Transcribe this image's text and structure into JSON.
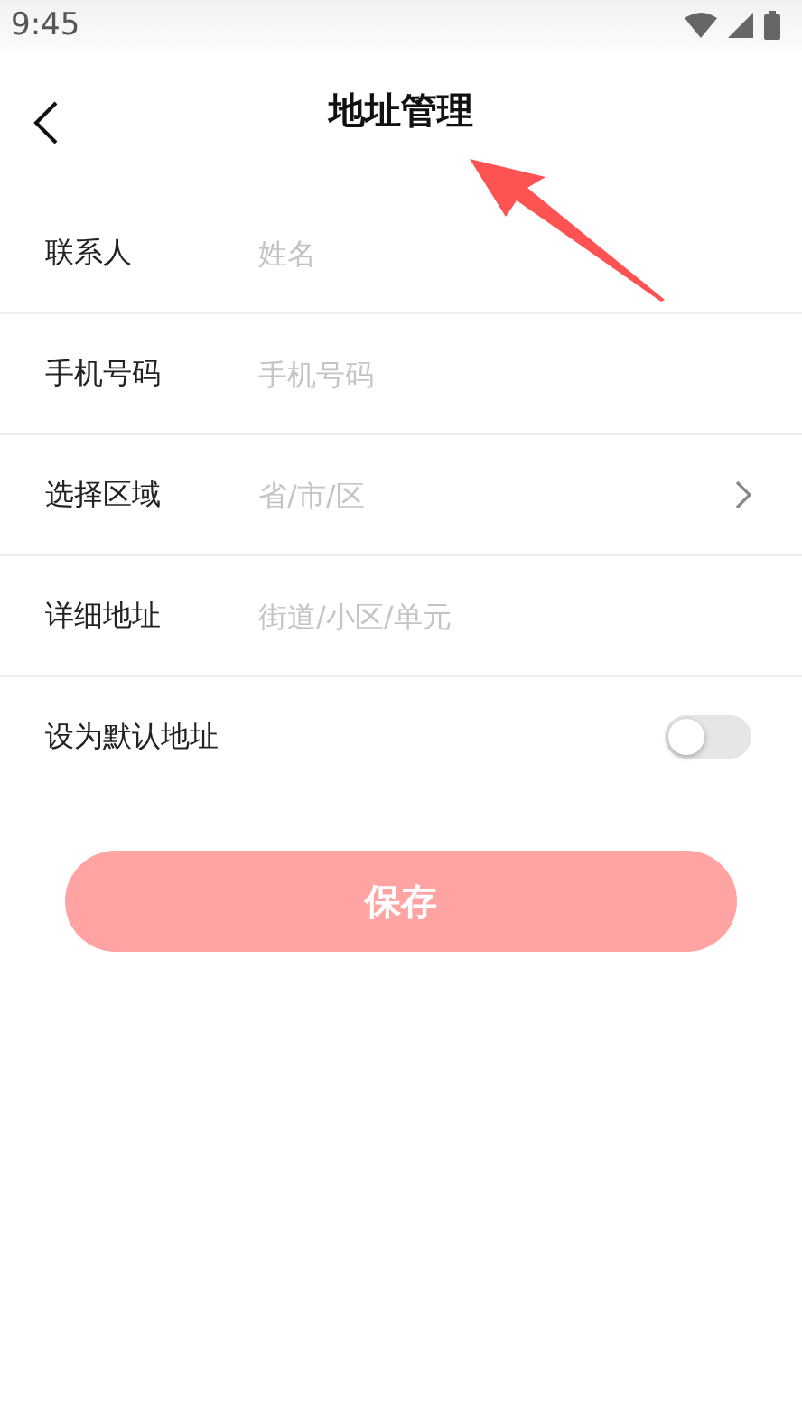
{
  "status_bar": {
    "time": "9:45"
  },
  "header": {
    "title": "地址管理"
  },
  "form": [
    {
      "kind": "input",
      "label": "联系人",
      "placeholder": "姓名"
    },
    {
      "kind": "input",
      "label": "手机号码",
      "placeholder": "手机号码"
    },
    {
      "kind": "picker",
      "label": "选择区域",
      "placeholder": "省/市/区"
    },
    {
      "kind": "input",
      "label": "详细地址",
      "placeholder": "街道/小区/单元"
    },
    {
      "kind": "toggle",
      "label": "设为默认地址",
      "on": false
    }
  ],
  "save_button": {
    "label": "保存",
    "disabled": true
  },
  "annotation": {
    "kind": "arrow"
  }
}
